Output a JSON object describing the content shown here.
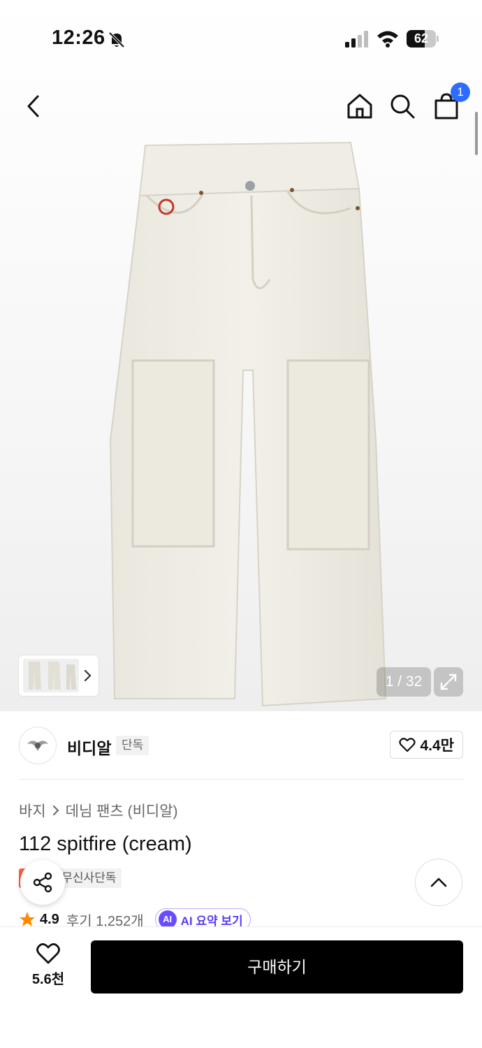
{
  "status_bar": {
    "time": "12:26",
    "battery": "62",
    "battery_level_percent": 62,
    "icons": [
      "bell-off-icon",
      "signal-icon",
      "wifi-icon",
      "battery-icon"
    ]
  },
  "nav": {
    "icons": [
      "chevron-left-icon",
      "home-icon",
      "search-icon",
      "shopping-bag-icon"
    ],
    "cart_badge": "1"
  },
  "gallery": {
    "counter": "1 / 32",
    "current": 1,
    "total": 32
  },
  "brand": {
    "name": "비디알",
    "tag": "단독",
    "likes": "4.4만"
  },
  "breadcrumb": {
    "items": [
      "바지",
      "데님 팬츠 (비디알)"
    ]
  },
  "product": {
    "title": "112 spitfire (cream)",
    "tags": [
      "세일",
      "무신사단독"
    ],
    "tag_visible_text": "세일",
    "rating": "4.9",
    "review_text": "후기 1,252개",
    "ai_badge": "AI",
    "ai_label": "AI 요약 보기"
  },
  "bottom": {
    "wish_count": "5.6천",
    "buy_label": "구매하기"
  },
  "colors": {
    "accent_blue": "#2d6cff",
    "sale_red": "#ff5e44",
    "ai_purple": "#6a4cff",
    "star": "#ff8a00",
    "buy_button": "#000000"
  }
}
